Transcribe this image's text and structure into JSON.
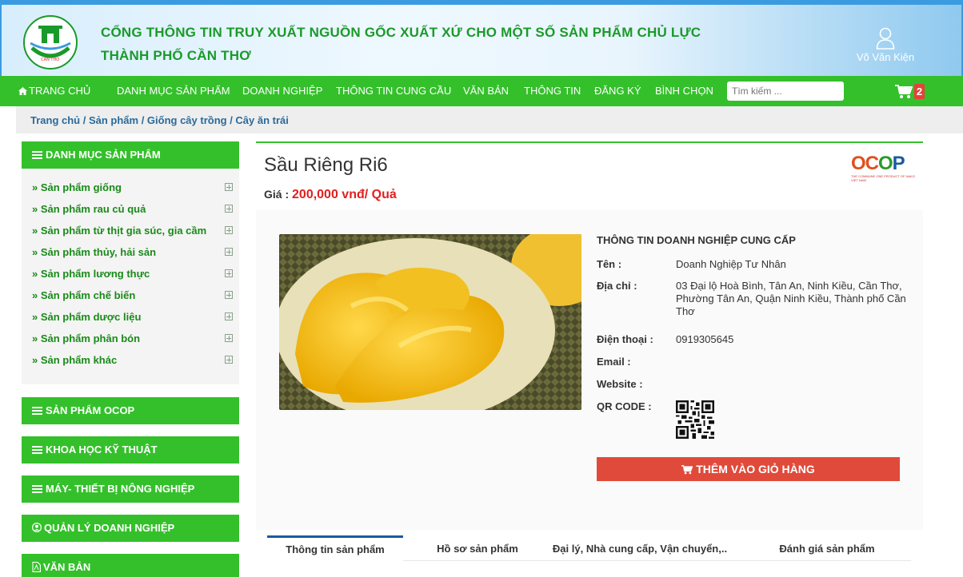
{
  "header": {
    "title_line1": "CỔNG THÔNG TIN TRUY XUẤT NGUỒN GỐC XUẤT XỨ CHO MỘT SỐ SẢN PHẨM CHỦ LỰC",
    "title_line2": "THÀNH PHỐ CẦN THƠ",
    "user_name": "Võ Văn Kiện"
  },
  "nav": {
    "items": [
      "TRANG CHỦ",
      "DANH MỤC SẢN PHẨM",
      "DOANH NGHIỆP",
      "THÔNG TIN CUNG CẦU",
      "VĂN BẢN",
      "THÔNG TIN",
      "ĐĂNG KÝ",
      "BÌNH CHỌN"
    ],
    "search_placeholder": "Tìm kiếm ...",
    "cart_count": "2"
  },
  "breadcrumb": "Trang chủ / Sản phẩm / Giống cây trồng / Cây ăn trái",
  "sidebar": {
    "category_title": "DANH MỤC SẢN PHẨM",
    "items": [
      "» Sản phẩm giống",
      "» Sản phẩm rau củ quả",
      "» Sản phẩm từ thịt gia súc, gia cầm",
      "» Sản phẩm thủy, hải sản",
      "» Sản phẩm lương thực",
      "» Sản phẩm chế biến",
      "» Sản phẩm dược liệu",
      "» Sản phẩm phân bón",
      "» Sản phẩm khác"
    ],
    "sections": [
      "SẢN PHẨM OCOP",
      "KHOA HỌC KỸ THUẬT",
      "MÁY- THIẾT BỊ NÔNG NGHIỆP",
      "QUẢN LÝ DOANH NGHIỆP",
      "VĂN BẢN"
    ]
  },
  "product": {
    "name": "Sầu Riêng Ri6",
    "price_label": "Giá : ",
    "price_value": "200,000 vnđ/ Quả",
    "ocop_logo": "OCOP",
    "ocop_sub": "THE COMMUNE ONE PRODUCT OF NAKG VIET NAM"
  },
  "supplier": {
    "heading": "THÔNG TIN DOANH NGHIỆP CUNG CẤP",
    "name_label": "Tên :",
    "name_value": "Doanh Nghiệp Tư Nhân",
    "address_label": "Địa chỉ :",
    "address_value": "03 Đại lộ Hoà Bình, Tân An, Ninh Kiều, Cần Thơ, Phường Tân An, Quận Ninh Kiều, Thành phố Cần Thơ",
    "phone_label": "Điện thoại :",
    "phone_value": "0919305645",
    "email_label": "Email :",
    "website_label": "Website :",
    "qr_label": "QR CODE :"
  },
  "add_to_cart": "THÊM VÀO GIỎ HÀNG",
  "tabs": [
    "Thông tin sản phẩm",
    "Hồ sơ sản phẩm",
    "Đại lý, Nhà cung cấp, Vận chuyển,..",
    "Đánh giá sản phẩm"
  ],
  "colors": {
    "green": "#34c02b",
    "red": "#e04a3a",
    "blue": "#3b9be0"
  }
}
